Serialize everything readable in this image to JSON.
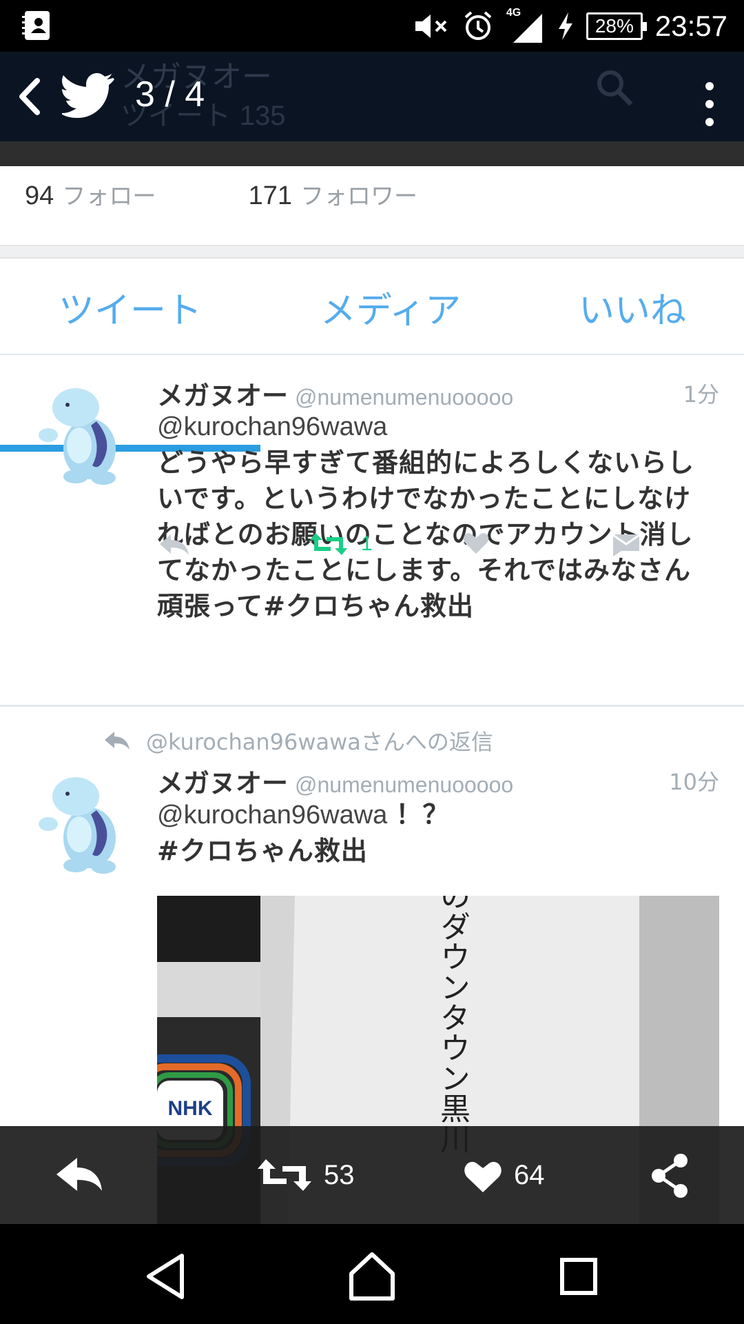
{
  "status_bar": {
    "time": "23:57",
    "battery": "28%",
    "network": "4G",
    "icons": [
      "contacts-icon",
      "mute-icon",
      "alarm-icon",
      "signal-icon",
      "charging-icon",
      "battery-icon"
    ]
  },
  "viewer": {
    "counter": "3 / 4",
    "background_profile_name": "メガヌオー",
    "background_tweets_label": "ツイート",
    "background_tweets_count": "135"
  },
  "profile": {
    "following_count": "94",
    "following_label": "フォロー",
    "followers_count": "171",
    "followers_label": "フォロワー"
  },
  "tabs": [
    {
      "label": "ツイート",
      "active": true
    },
    {
      "label": "メディア",
      "active": false
    },
    {
      "label": "いいね",
      "active": false
    }
  ],
  "tweets": [
    {
      "name": "メガヌオー",
      "handle": "@numenumenuooooo",
      "time": "1分",
      "mention": "@kurochan96wawa",
      "text": "どうやら早すぎて番組的によろしくないらしいです。というわけでなかったことにしなければとのお願いのことなのでアカウント消してなかったことにします。それではみなさん頑張って#クロちゃん救出",
      "retweet_count": "1"
    },
    {
      "reply_context": "@kurochan96wawaさんへの返信",
      "name": "メガヌオー",
      "handle": "@numenumenuooooo",
      "time": "10分",
      "mention": "@kurochan96wawa",
      "mention_suffix": "！？",
      "text": "#クロちゃん救出",
      "media": {
        "logo_text": "NHK",
        "vertical_text": "のダウンタウン黒川"
      }
    }
  ],
  "bottom_bar": {
    "retweets": "53",
    "likes": "64"
  },
  "colors": {
    "accent": "#55acee",
    "retweet_green": "#19cf86",
    "muted": "#a4adb5"
  }
}
